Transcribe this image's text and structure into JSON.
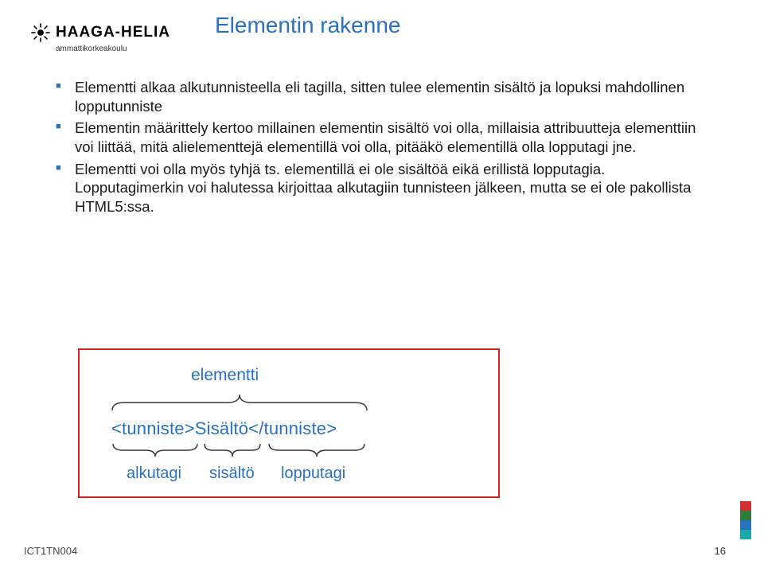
{
  "logo": {
    "name": "HAAGA-HELIA",
    "subtitle": "ammattikorkeakoulu"
  },
  "title": "Elementin rakenne",
  "bullets": [
    "Elementti alkaa alkutunnisteella eli tagilla, sitten tulee elementin sisältö ja lopuksi mahdollinen lopputunniste",
    "Elementin määrittely kertoo millainen elementin sisältö voi olla, millaisia attribuutteja elementtiin voi liittää, mitä alielementtejä elementillä voi olla, pitääkö elementillä olla lopputagi jne.",
    "Elementti voi olla myös tyhjä ts. elementillä ei ole sisältöä eikä erillistä lopputagia. Lopputagimerkin voi halutessa kirjoittaa alkutagiin tunnisteen jälkeen, mutta se ei ole pakollista HTML5:ssa."
  ],
  "diagram": {
    "topLabel": "elementti",
    "code": "<tunniste>Sisältö</tunniste>",
    "bottom": {
      "start": "alkutagi",
      "content": "sisältö",
      "end": "lopputagi"
    }
  },
  "footer": {
    "course": "ICT1TN004",
    "page": "16"
  },
  "palette": [
    "#d22f2f",
    "#2f7d38",
    "#2871c0",
    "#1aa8a8"
  ]
}
